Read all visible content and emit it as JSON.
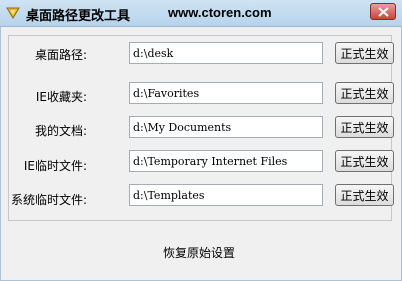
{
  "window": {
    "title": "桌面路径更改工具",
    "site": "www.ctoren.com"
  },
  "rows": [
    {
      "label": "桌面路径:",
      "value": "d:\\desk",
      "button": "正式生效"
    },
    {
      "label": "IE收藏夹:",
      "value": "d:\\Favorites",
      "button": "正式生效"
    },
    {
      "label": "我的文档:",
      "value": "d:\\My Documents",
      "button": "正式生效"
    },
    {
      "label": "IE临时文件:",
      "value": "d:\\Temporary Internet Files",
      "button": "正式生效"
    },
    {
      "label": "系统临时文件:",
      "value": "d:\\Templates",
      "button": "正式生效"
    }
  ],
  "restore_label": "恢复原始设置",
  "colors": {
    "titlebar": "#c6dcf0",
    "close_button": "#c9443a",
    "client_background": "#f0f0f0"
  },
  "icons": {
    "app": "gold-arrow-icon",
    "close": "close-icon"
  }
}
